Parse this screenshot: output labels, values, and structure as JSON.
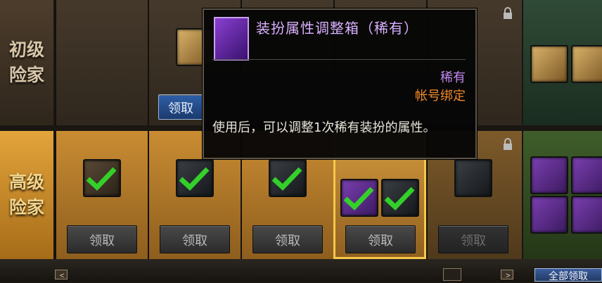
{
  "rows": {
    "top": {
      "label": "初级\n险家"
    },
    "bottom": {
      "label": "高级\n险家"
    }
  },
  "buttons": {
    "claim": "领取",
    "claim_blue": "领取",
    "all_claim": "全部领取"
  },
  "navigation": {
    "prev": "<",
    "next": ">"
  },
  "tooltip": {
    "title": "装扮属性调整箱（稀有）",
    "rarity": "稀有",
    "binding": "帐号绑定",
    "description": "使用后，可以调整1次稀有装扮的属性。",
    "colors": {
      "title": "#d9b0ff",
      "rarity": "#c08af0",
      "binding": "#f08a2a"
    }
  },
  "icons": [
    "check-icon",
    "lock-icon",
    "chest-icon",
    "costume-icon"
  ],
  "colors": {
    "accent": "#f5c84a",
    "button": "#2b2b2b"
  }
}
